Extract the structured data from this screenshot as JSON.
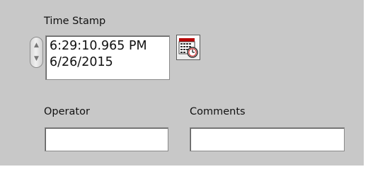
{
  "timestamp": {
    "label": "Time Stamp",
    "time": "6:29:10.965 PM",
    "date": "6/26/2015",
    "stepper_up_icon": "triangle-up",
    "stepper_down_icon": "triangle-down",
    "browse_icon": "calendar-clock-icon"
  },
  "operator": {
    "label": "Operator",
    "value": ""
  },
  "comments": {
    "label": "Comments",
    "value": ""
  },
  "colors": {
    "panel_bg": "#c8c8c8",
    "field_bg": "#ffffff",
    "calendar_header": "#b80000",
    "clock_accent": "#d01010"
  }
}
